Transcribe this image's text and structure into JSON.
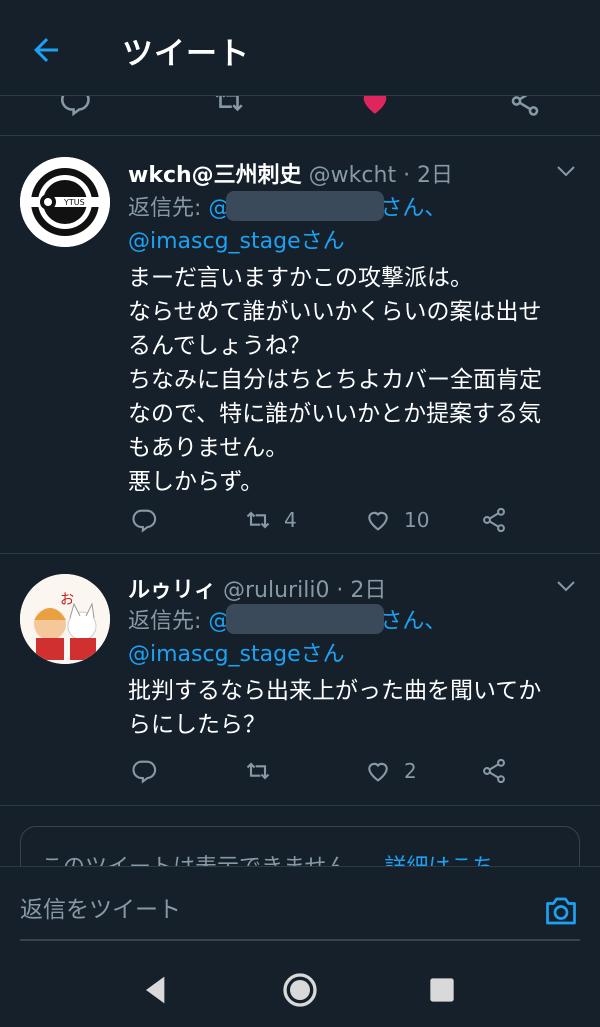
{
  "header": {
    "title": "ツイート",
    "back_icon": "arrow-left-icon"
  },
  "colors": {
    "background": "#15202b",
    "accent": "#1da1f2",
    "muted": "#8899a6",
    "like_active": "#e0245e"
  },
  "tweets": [
    {
      "name": "wkch@三州刺史",
      "handle": "@wkcht · 2日",
      "reply_label": "返信先:",
      "reply_at": "@",
      "reply_suffix": "さん、",
      "reply_second": "@imascg_stageさん",
      "body": [
        "まーだ言いますかこの攻撃派は。",
        "ならせめて誰がいいかくらいの案は出せ",
        "るんでしょうね？",
        "ちなみに自分はちとちよカバー全面肯定",
        "なので、特に誰がいいかとか提案する気",
        "もありません。",
        "悪しからず。"
      ],
      "retweets": "4",
      "likes": "10"
    },
    {
      "name": "ルゥリィ",
      "handle": "@rulurili0 · 2日",
      "reply_label": "返信先:",
      "reply_at": "@",
      "reply_suffix": "さん、",
      "reply_second": "@imascg_stageさん",
      "body": [
        "批判するなら出来上がった曲を聞いてか",
        "らにしたら？"
      ],
      "retweets": "",
      "likes": "2"
    }
  ],
  "unavailable": {
    "text": "このツイートは表示できません。",
    "link": "詳細はこち"
  },
  "reply_bar": {
    "placeholder": "返信をツイート",
    "icon": "camera-icon"
  },
  "nav": {
    "back": "nav-back-icon",
    "home": "nav-home-icon",
    "recents": "nav-recents-icon"
  }
}
